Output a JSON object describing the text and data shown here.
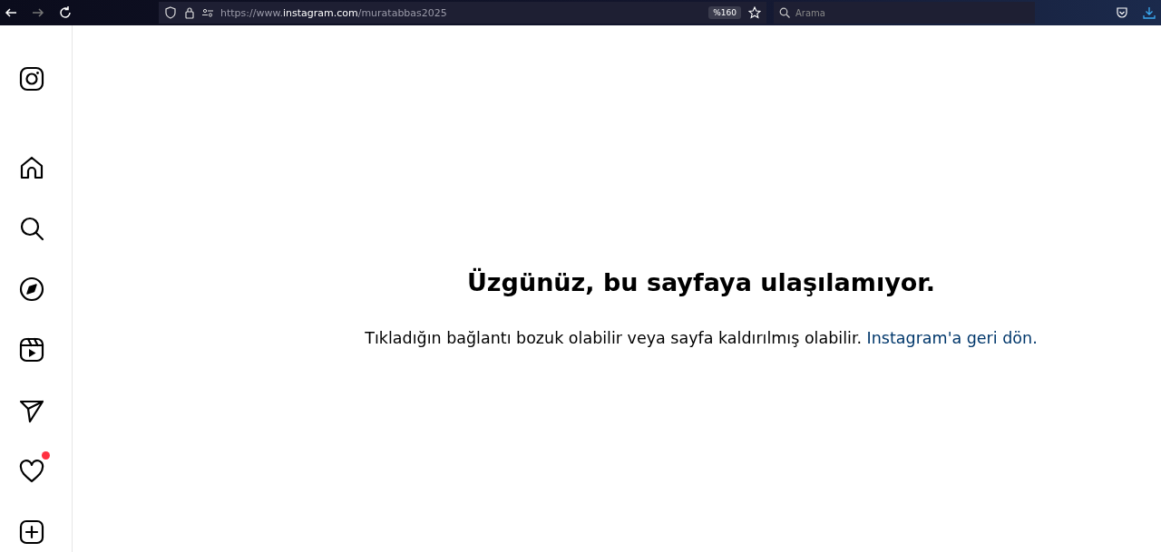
{
  "browser": {
    "url_scheme": "https://www.",
    "url_host": "instagram.com",
    "url_path": "/muratabbas2025",
    "zoom": "%160",
    "search": {
      "placeholder": "Arama"
    }
  },
  "sidebar": {
    "items": [
      {
        "kind": "logo",
        "notification": false
      },
      {
        "kind": "home",
        "notification": false
      },
      {
        "kind": "search",
        "notification": false
      },
      {
        "kind": "explore",
        "notification": false
      },
      {
        "kind": "reels",
        "notification": false
      },
      {
        "kind": "messages",
        "notification": false
      },
      {
        "kind": "notifications",
        "notification": true
      },
      {
        "kind": "create",
        "notification": false
      }
    ]
  },
  "error": {
    "title": "Üzgünüz, bu sayfaya ulaşılamıyor.",
    "message": "Tıkladığın bağlantı bozuk olabilir veya sayfa kaldırılmış olabilir.",
    "link": "Instagram'a geri dön."
  }
}
